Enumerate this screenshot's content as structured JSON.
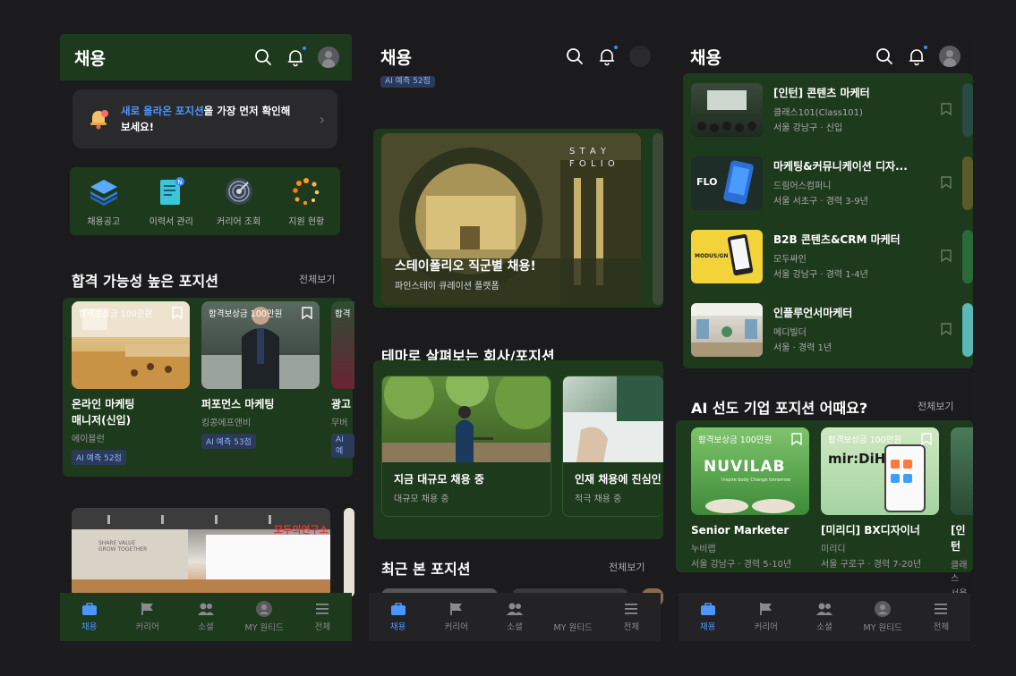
{
  "app": {
    "title": "채용"
  },
  "p1": {
    "banner": {
      "hl": "새로 올라온 포지션",
      "rest1": "을 가장 먼저 확인해",
      "rest2": "보세요!"
    },
    "quick": [
      "채용공고",
      "이력서 관리",
      "커리어 조회",
      "지원 현황"
    ],
    "section": "합격 가능성 높은 포지션",
    "see_all": "전체보기",
    "positions": [
      {
        "tag": "합격보상금 100만원",
        "title1": "온라인 마케팅",
        "title2": "매니저(신입)",
        "company": "에이블런",
        "ai": "AI 예측 52점"
      },
      {
        "tag": "합격보상금 100만원",
        "title1": "퍼포먼스 마케팅",
        "title2": "",
        "company": "킹콩에프앤비",
        "ai": "AI 예측 53점"
      },
      {
        "tag": "합격",
        "title1": "광고",
        "title2": "",
        "company": "무버",
        "ai": "AI 예"
      }
    ],
    "banner2_text": "모두의연구소",
    "banner2_wall": "SHARE VALUE GROW TOGETHER"
  },
  "p2": {
    "top_ai": "AI 예측 52점",
    "hero": {
      "brand1": "S T A Y",
      "brand2": "F O L I O",
      "title": "스테이폴리오 직군별 채용!",
      "sub": "파인스테이 큐레이션 플랫폼"
    },
    "section": "테마로 살펴보는 회사/포지션",
    "themes": [
      {
        "title": "지금 대규모 채용 중",
        "sub": "대규모 채용 중"
      },
      {
        "title": "인재 채용에 진심인",
        "sub": "적극 채용 중"
      }
    ],
    "recent": "최근 본 포지션",
    "see_all": "전체보기"
  },
  "p3": {
    "list": [
      {
        "title": "[인턴] 콘텐츠 마케터",
        "company": "클래스101(Class101)",
        "loc": "서울 강남구 · 신입"
      },
      {
        "title": "마케팅&커뮤니케이션 디자...",
        "company": "드림어스컴퍼니",
        "loc": "서울 서초구 · 경력 3-9년"
      },
      {
        "title": "B2B 콘텐츠&CRM 마케터",
        "company": "모두싸인",
        "loc": "서울 강남구 · 경력 1-4년"
      },
      {
        "title": "인플루언서마케터",
        "company": "메디빌더",
        "loc": "서울 · 경력 1년"
      }
    ],
    "flo": "FLO",
    "modus": "MODUS/GN",
    "section": "AI 선도 기업 포지션 어때요?",
    "see_all": "전체보기",
    "positions": [
      {
        "tag": "합격보상금 100만원",
        "logo": "NUVILAB",
        "logo_sub": "Inspire body Change tomorrow",
        "title": "Senior Marketer",
        "company": "누비랩",
        "loc": "서울 강남구 · 경력 5-10년"
      },
      {
        "tag": "합격보상금 100만원",
        "logo": "mir:DiH",
        "logo_sub": "",
        "title": "[미리디] BX디자이너",
        "company": "미리디",
        "loc": "서울 구로구 · 경력 7-20년"
      },
      {
        "tag": "",
        "logo": "",
        "logo_sub": "",
        "title": "[인턴",
        "company": "클래스",
        "loc": "서울"
      }
    ]
  },
  "tabs": [
    "채용",
    "커리어",
    "소셜",
    "MY 원티드",
    "전체"
  ],
  "colors": {
    "accent": "#4b97ff",
    "green_panel": "#1d3a1c",
    "bg": "#1b1b1d"
  }
}
